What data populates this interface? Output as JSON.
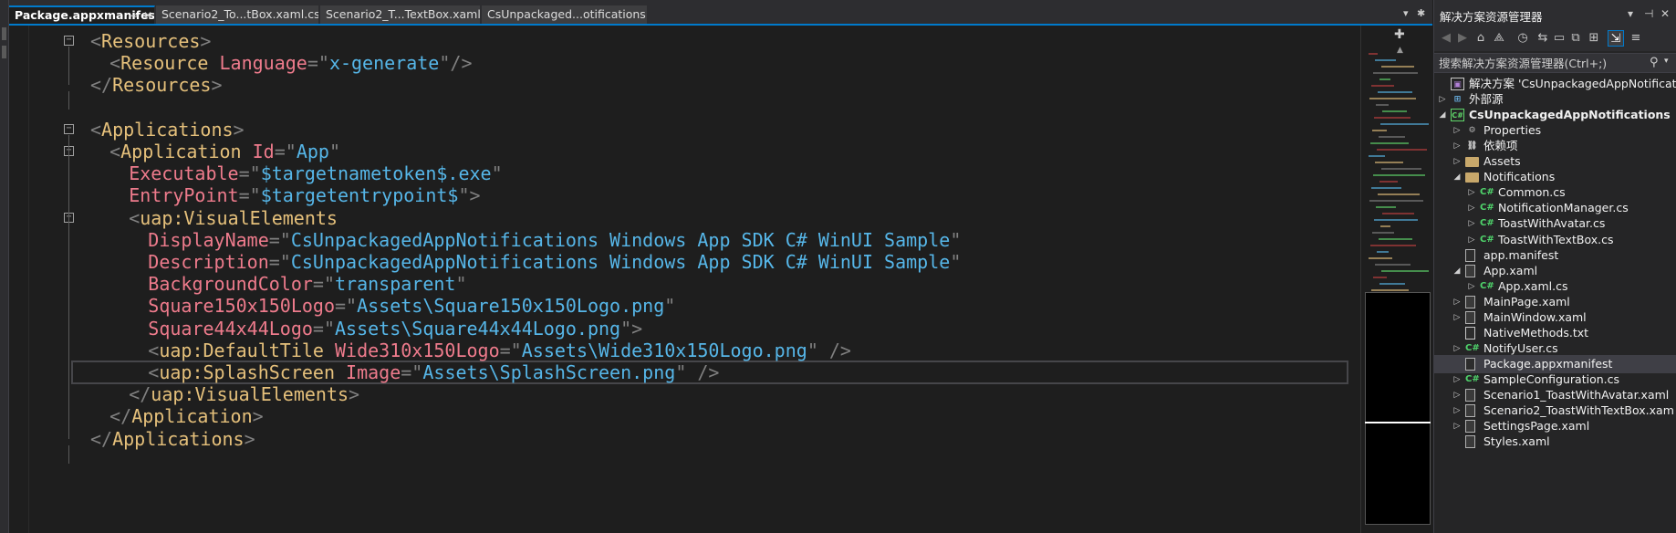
{
  "tabs": [
    {
      "label": "Package.appxmanifest",
      "active": true
    },
    {
      "label": "Scenario2_To...tBox.xaml.cs",
      "active": false
    },
    {
      "label": "Scenario2_T...TextBox.xaml",
      "active": false
    },
    {
      "label": "CsUnpackaged...otifications",
      "active": false
    }
  ],
  "tab_icons": {
    "pin": "⊸",
    "close": "✕",
    "dropdown": "▾",
    "settings": "✱"
  },
  "editor": {
    "lines": [
      [
        [
          "p",
          "<"
        ],
        [
          "t",
          "Resources"
        ],
        [
          "p",
          ">"
        ]
      ],
      [
        [
          "p",
          "<"
        ],
        [
          "t",
          "Resource"
        ],
        [
          "p",
          " "
        ],
        [
          "a",
          "Language"
        ],
        [
          "p",
          "=\""
        ],
        [
          "v",
          "x-generate"
        ],
        [
          "p",
          "\"/>"
        ]
      ],
      [
        [
          "p",
          "</"
        ],
        [
          "t",
          "Resources"
        ],
        [
          "p",
          ">"
        ]
      ],
      [],
      [
        [
          "p",
          "<"
        ],
        [
          "t",
          "Applications"
        ],
        [
          "p",
          ">"
        ]
      ],
      [
        [
          "p",
          "<"
        ],
        [
          "t",
          "Application"
        ],
        [
          "p",
          " "
        ],
        [
          "a",
          "Id"
        ],
        [
          "p",
          "=\""
        ],
        [
          "v",
          "App"
        ],
        [
          "p",
          "\""
        ]
      ],
      [
        [
          "a",
          "Executable"
        ],
        [
          "p",
          "=\""
        ],
        [
          "v",
          "$targetnametoken$.exe"
        ],
        [
          "p",
          "\""
        ]
      ],
      [
        [
          "a",
          "EntryPoint"
        ],
        [
          "p",
          "=\""
        ],
        [
          "v",
          "$targetentrypoint$"
        ],
        [
          "p",
          "\">"
        ]
      ],
      [
        [
          "p",
          "<"
        ],
        [
          "t",
          "uap:VisualElements"
        ]
      ],
      [
        [
          "a",
          "DisplayName"
        ],
        [
          "p",
          "=\""
        ],
        [
          "v",
          "CsUnpackagedAppNotifications Windows App SDK C# WinUI Sample"
        ],
        [
          "p",
          "\""
        ]
      ],
      [
        [
          "a",
          "Description"
        ],
        [
          "p",
          "=\""
        ],
        [
          "v",
          "CsUnpackagedAppNotifications Windows App SDK C# WinUI Sample"
        ],
        [
          "p",
          "\""
        ]
      ],
      [
        [
          "a",
          "BackgroundColor"
        ],
        [
          "p",
          "=\""
        ],
        [
          "v",
          "transparent"
        ],
        [
          "p",
          "\""
        ]
      ],
      [
        [
          "a",
          "Square150x150Logo"
        ],
        [
          "p",
          "=\""
        ],
        [
          "v",
          "Assets\\Square150x150Logo.png"
        ],
        [
          "p",
          "\""
        ]
      ],
      [
        [
          "a",
          "Square44x44Logo"
        ],
        [
          "p",
          "=\""
        ],
        [
          "v",
          "Assets\\Square44x44Logo.png"
        ],
        [
          "p",
          "\">"
        ]
      ],
      [
        [
          "p",
          "<"
        ],
        [
          "t",
          "uap:DefaultTile"
        ],
        [
          "p",
          " "
        ],
        [
          "a",
          "Wide310x150Logo"
        ],
        [
          "p",
          "=\""
        ],
        [
          "v",
          "Assets\\Wide310x150Logo.png"
        ],
        [
          "p",
          "\" />"
        ]
      ],
      [
        [
          "p",
          "<"
        ],
        [
          "t",
          "uap:SplashScreen"
        ],
        [
          "p",
          " "
        ],
        [
          "a",
          "Image"
        ],
        [
          "p",
          "=\""
        ],
        [
          "v",
          "Assets\\SplashScreen.png"
        ],
        [
          "p",
          "\" />"
        ]
      ],
      [
        [
          "p",
          "</"
        ],
        [
          "t",
          "uap:VisualElements"
        ],
        [
          "p",
          ">"
        ]
      ],
      [
        [
          "p",
          "</"
        ],
        [
          "t",
          "Application"
        ],
        [
          "p",
          ">"
        ]
      ],
      [
        [
          "p",
          "</"
        ],
        [
          "t",
          "Applications"
        ],
        [
          "p",
          ">"
        ]
      ]
    ],
    "current_line": 15,
    "colors": {
      "punct": "#808080",
      "tag": "#e5c07b",
      "attr": "#ee7b8c",
      "value": "#56b6e8",
      "background": "#1e1e1e"
    }
  },
  "solution_explorer": {
    "title": "解决方案资源管理器",
    "title_buttons": [
      "▾",
      "⊣",
      "✕"
    ],
    "toolbar": [
      "◀",
      "▶",
      "⌂",
      "⟁",
      "◷",
      "⇆",
      "▭",
      "⧉",
      "⊞",
      "⇲",
      "≡"
    ],
    "search_placeholder": "搜索解决方案资源管理器(Ctrl+;)",
    "search_icon": "⚲",
    "items": [
      {
        "label": "解决方案 'CsUnpackagedAppNotificatio",
        "icon": "solution-icon",
        "glyph": "▣"
      },
      {
        "label": "外部源",
        "icon": "external-sources-icon",
        "glyph": "⊞"
      },
      {
        "label": "CsUnpackagedAppNotifications",
        "icon": "csharp-project-icon",
        "glyph": "C#"
      },
      {
        "label": "Properties",
        "icon": "properties-icon",
        "glyph": "⚙"
      },
      {
        "label": "依赖项",
        "icon": "dependencies-icon",
        "glyph": "⛓"
      },
      {
        "label": "Assets",
        "icon": "folder-icon",
        "glyph": ""
      },
      {
        "label": "Notifications",
        "icon": "folder-icon",
        "glyph": ""
      },
      {
        "label": "Common.cs",
        "icon": "csharp-file-icon",
        "glyph": "C#"
      },
      {
        "label": "NotificationManager.cs",
        "icon": "csharp-file-icon",
        "glyph": "C#"
      },
      {
        "label": "ToastWithAvatar.cs",
        "icon": "csharp-file-icon",
        "glyph": "C#"
      },
      {
        "label": "ToastWithTextBox.cs",
        "icon": "csharp-file-icon",
        "glyph": "C#"
      },
      {
        "label": "app.manifest",
        "icon": "manifest-icon",
        "glyph": ""
      },
      {
        "label": "App.xaml",
        "icon": "xaml-file-icon",
        "glyph": ""
      },
      {
        "label": "App.xaml.cs",
        "icon": "csharp-file-icon",
        "glyph": "C#"
      },
      {
        "label": "MainPage.xaml",
        "icon": "xaml-file-icon",
        "glyph": ""
      },
      {
        "label": "MainWindow.xaml",
        "icon": "xaml-file-icon",
        "glyph": ""
      },
      {
        "label": "NativeMethods.txt",
        "icon": "text-file-icon",
        "glyph": ""
      },
      {
        "label": "NotifyUser.cs",
        "icon": "csharp-file-icon",
        "glyph": "C#"
      },
      {
        "label": "Package.appxmanifest",
        "icon": "manifest-icon",
        "glyph": ""
      },
      {
        "label": "SampleConfiguration.cs",
        "icon": "csharp-file-icon",
        "glyph": "C#"
      },
      {
        "label": "Scenario1_ToastWithAvatar.xaml",
        "icon": "xaml-file-icon",
        "glyph": ""
      },
      {
        "label": "Scenario2_ToastWithTextBox.xam",
        "icon": "xaml-file-icon",
        "glyph": ""
      },
      {
        "label": "SettingsPage.xaml",
        "icon": "xaml-file-icon",
        "glyph": ""
      },
      {
        "label": "Styles.xaml",
        "icon": "xaml-file-icon",
        "glyph": ""
      }
    ],
    "selected_item": 18
  }
}
